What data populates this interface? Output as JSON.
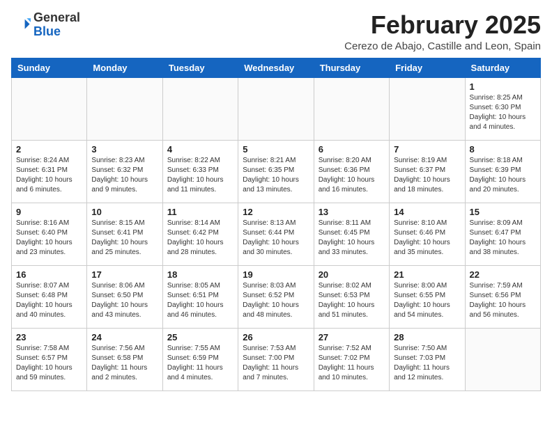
{
  "header": {
    "logo_general": "General",
    "logo_blue": "Blue",
    "month_title": "February 2025",
    "location": "Cerezo de Abajo, Castille and Leon, Spain"
  },
  "weekdays": [
    "Sunday",
    "Monday",
    "Tuesday",
    "Wednesday",
    "Thursday",
    "Friday",
    "Saturday"
  ],
  "weeks": [
    [
      {
        "day": "",
        "info": ""
      },
      {
        "day": "",
        "info": ""
      },
      {
        "day": "",
        "info": ""
      },
      {
        "day": "",
        "info": ""
      },
      {
        "day": "",
        "info": ""
      },
      {
        "day": "",
        "info": ""
      },
      {
        "day": "1",
        "info": "Sunrise: 8:25 AM\nSunset: 6:30 PM\nDaylight: 10 hours\nand 4 minutes."
      }
    ],
    [
      {
        "day": "2",
        "info": "Sunrise: 8:24 AM\nSunset: 6:31 PM\nDaylight: 10 hours\nand 6 minutes."
      },
      {
        "day": "3",
        "info": "Sunrise: 8:23 AM\nSunset: 6:32 PM\nDaylight: 10 hours\nand 9 minutes."
      },
      {
        "day": "4",
        "info": "Sunrise: 8:22 AM\nSunset: 6:33 PM\nDaylight: 10 hours\nand 11 minutes."
      },
      {
        "day": "5",
        "info": "Sunrise: 8:21 AM\nSunset: 6:35 PM\nDaylight: 10 hours\nand 13 minutes."
      },
      {
        "day": "6",
        "info": "Sunrise: 8:20 AM\nSunset: 6:36 PM\nDaylight: 10 hours\nand 16 minutes."
      },
      {
        "day": "7",
        "info": "Sunrise: 8:19 AM\nSunset: 6:37 PM\nDaylight: 10 hours\nand 18 minutes."
      },
      {
        "day": "8",
        "info": "Sunrise: 8:18 AM\nSunset: 6:39 PM\nDaylight: 10 hours\nand 20 minutes."
      }
    ],
    [
      {
        "day": "9",
        "info": "Sunrise: 8:16 AM\nSunset: 6:40 PM\nDaylight: 10 hours\nand 23 minutes."
      },
      {
        "day": "10",
        "info": "Sunrise: 8:15 AM\nSunset: 6:41 PM\nDaylight: 10 hours\nand 25 minutes."
      },
      {
        "day": "11",
        "info": "Sunrise: 8:14 AM\nSunset: 6:42 PM\nDaylight: 10 hours\nand 28 minutes."
      },
      {
        "day": "12",
        "info": "Sunrise: 8:13 AM\nSunset: 6:44 PM\nDaylight: 10 hours\nand 30 minutes."
      },
      {
        "day": "13",
        "info": "Sunrise: 8:11 AM\nSunset: 6:45 PM\nDaylight: 10 hours\nand 33 minutes."
      },
      {
        "day": "14",
        "info": "Sunrise: 8:10 AM\nSunset: 6:46 PM\nDaylight: 10 hours\nand 35 minutes."
      },
      {
        "day": "15",
        "info": "Sunrise: 8:09 AM\nSunset: 6:47 PM\nDaylight: 10 hours\nand 38 minutes."
      }
    ],
    [
      {
        "day": "16",
        "info": "Sunrise: 8:07 AM\nSunset: 6:48 PM\nDaylight: 10 hours\nand 40 minutes."
      },
      {
        "day": "17",
        "info": "Sunrise: 8:06 AM\nSunset: 6:50 PM\nDaylight: 10 hours\nand 43 minutes."
      },
      {
        "day": "18",
        "info": "Sunrise: 8:05 AM\nSunset: 6:51 PM\nDaylight: 10 hours\nand 46 minutes."
      },
      {
        "day": "19",
        "info": "Sunrise: 8:03 AM\nSunset: 6:52 PM\nDaylight: 10 hours\nand 48 minutes."
      },
      {
        "day": "20",
        "info": "Sunrise: 8:02 AM\nSunset: 6:53 PM\nDaylight: 10 hours\nand 51 minutes."
      },
      {
        "day": "21",
        "info": "Sunrise: 8:00 AM\nSunset: 6:55 PM\nDaylight: 10 hours\nand 54 minutes."
      },
      {
        "day": "22",
        "info": "Sunrise: 7:59 AM\nSunset: 6:56 PM\nDaylight: 10 hours\nand 56 minutes."
      }
    ],
    [
      {
        "day": "23",
        "info": "Sunrise: 7:58 AM\nSunset: 6:57 PM\nDaylight: 10 hours\nand 59 minutes."
      },
      {
        "day": "24",
        "info": "Sunrise: 7:56 AM\nSunset: 6:58 PM\nDaylight: 11 hours\nand 2 minutes."
      },
      {
        "day": "25",
        "info": "Sunrise: 7:55 AM\nSunset: 6:59 PM\nDaylight: 11 hours\nand 4 minutes."
      },
      {
        "day": "26",
        "info": "Sunrise: 7:53 AM\nSunset: 7:00 PM\nDaylight: 11 hours\nand 7 minutes."
      },
      {
        "day": "27",
        "info": "Sunrise: 7:52 AM\nSunset: 7:02 PM\nDaylight: 11 hours\nand 10 minutes."
      },
      {
        "day": "28",
        "info": "Sunrise: 7:50 AM\nSunset: 7:03 PM\nDaylight: 11 hours\nand 12 minutes."
      },
      {
        "day": "",
        "info": ""
      }
    ]
  ]
}
